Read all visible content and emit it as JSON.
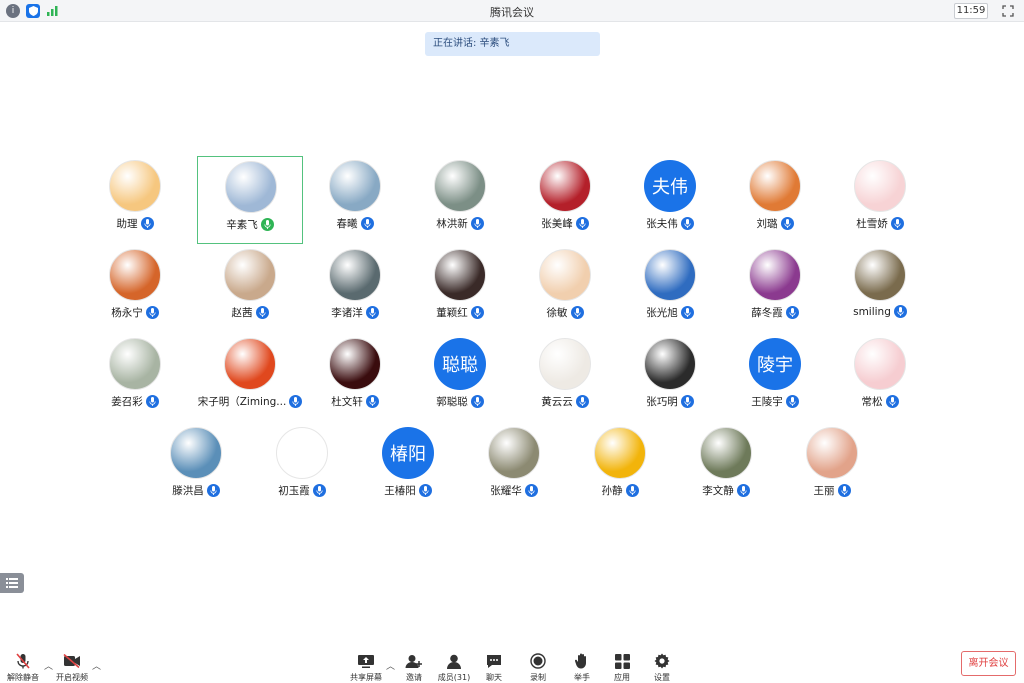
{
  "window": {
    "title": "腾讯会议",
    "clock": "11:59"
  },
  "speaking_banner": "正在讲话: 辛素飞",
  "participants": [
    {
      "name": "助理",
      "avatar": "cartoon-cat",
      "color": "#f6c77f"
    },
    {
      "name": "辛素飞",
      "avatar": "photo-building",
      "color": "#9fb8d6",
      "active": true
    },
    {
      "name": "春曦",
      "avatar": "photo-person-sea",
      "color": "#88a9c4"
    },
    {
      "name": "林洪新",
      "avatar": "photo-landscape",
      "color": "#7c8f86"
    },
    {
      "name": "张美峰",
      "avatar": "photo-cherries",
      "color": "#b4202a"
    },
    {
      "name": "张夫伟",
      "avatar_text": "夫伟",
      "color": "#1a73e8"
    },
    {
      "name": "刘璐",
      "avatar": "cartoon-animal",
      "color": "#e07a35"
    },
    {
      "name": "杜雪娇",
      "avatar": "cartoon-girl",
      "color": "#f7d3d5"
    },
    {
      "name": "杨永宁",
      "avatar": "photo-autumn-tree",
      "color": "#d5652a"
    },
    {
      "name": "赵茜",
      "avatar": "photo-sunset",
      "color": "#c9a98c"
    },
    {
      "name": "李诸洋",
      "avatar": "cartoon-face",
      "color": "#5a6a6f"
    },
    {
      "name": "董颖红",
      "avatar": "photo-woman",
      "color": "#3a2a28"
    },
    {
      "name": "徐敏",
      "avatar": "illustration",
      "color": "#f1cfae"
    },
    {
      "name": "张光旭",
      "avatar": "photo-blue-sky",
      "color": "#2f6cc0"
    },
    {
      "name": "薛冬霞",
      "avatar": "butterfly",
      "color": "#8b3a8f"
    },
    {
      "name": "smiling",
      "avatar": "photo-person-field",
      "color": "#7a6b4d"
    },
    {
      "name": "姜召彩",
      "avatar": "photo-food",
      "color": "#a8b4a3"
    },
    {
      "name": "宋子明（Ziming...",
      "avatar": "cartoon-girl-red",
      "color": "#e0481e"
    },
    {
      "name": "杜文轩",
      "avatar": "dark-symbol",
      "color": "#3a0c0e"
    },
    {
      "name": "郭聪聪",
      "avatar_text": "聪聪",
      "color": "#1a73e8"
    },
    {
      "name": "黄云云",
      "avatar": "sketch",
      "color": "#eeeae4"
    },
    {
      "name": "张巧明",
      "avatar": "kumamon",
      "color": "#2b2b2b"
    },
    {
      "name": "王陵宇",
      "avatar_text": "陵宇",
      "color": "#1a73e8"
    },
    {
      "name": "常松",
      "avatar": "cartoon-pink",
      "color": "#f6cdd1"
    },
    {
      "name": "滕洪昌",
      "avatar": "photo-pier",
      "color": "#5b8fb8"
    },
    {
      "name": "初玉霞",
      "avatar": "witch-cartoon",
      "color": "#ffffff"
    },
    {
      "name": "王椿阳",
      "avatar_text": "椿阳",
      "color": "#1a73e8"
    },
    {
      "name": "张耀华",
      "avatar": "photo-room",
      "color": "#8c8a72"
    },
    {
      "name": "孙静",
      "avatar": "sunflower",
      "color": "#f2b40b"
    },
    {
      "name": "李文静",
      "avatar": "photo-sheep",
      "color": "#6e7a5a"
    },
    {
      "name": "王丽",
      "avatar": "photo-sky-pink",
      "color": "#e2a38a"
    }
  ],
  "toolbar": {
    "unmute": "解除静音",
    "start_video": "开启视频",
    "share": "共享屏幕",
    "invite": "邀请",
    "members": "成员(31)",
    "chat": "聊天",
    "record": "录制",
    "raise_hand": "举手",
    "apps": "应用",
    "settings": "设置",
    "leave": "离开会议"
  },
  "colors": {
    "accent": "#1a73e8",
    "active_border": "#54c27e",
    "leave": "#e04040"
  }
}
